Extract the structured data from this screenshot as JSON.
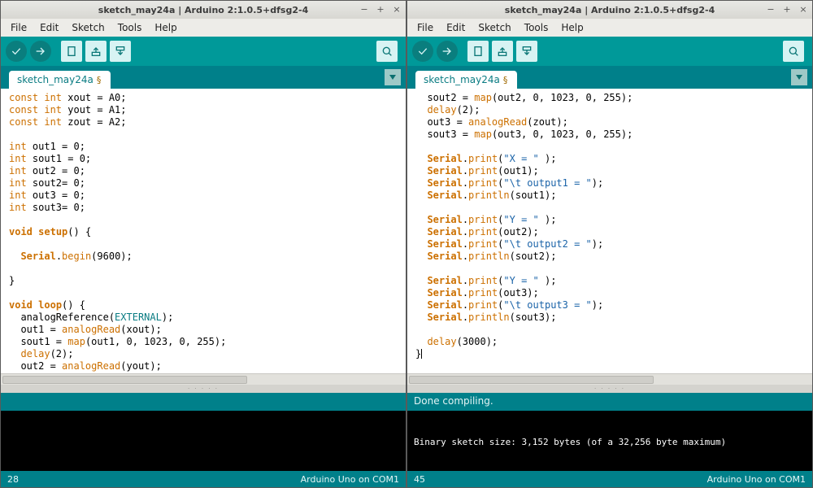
{
  "left": {
    "title": "sketch_may24a | Arduino 2:1.0.5+dfsg2-4",
    "menu": [
      "File",
      "Edit",
      "Sketch",
      "Tools",
      "Help"
    ],
    "tab": "sketch_may24a",
    "dirty_marker": "§",
    "status_teal": "",
    "console": "",
    "line_no": "28",
    "board": "Arduino Uno on COM1",
    "code_tokens": [
      [
        [
          "ty",
          "const int"
        ],
        [
          "",
          " xout = A0;"
        ]
      ],
      [
        [
          "ty",
          "const int"
        ],
        [
          "",
          " yout = A1;"
        ]
      ],
      [
        [
          "ty",
          "const int"
        ],
        [
          "",
          " zout = A2;"
        ]
      ],
      [
        [
          "",
          ""
        ]
      ],
      [
        [
          "ty",
          "int"
        ],
        [
          "",
          " out1 = 0;"
        ]
      ],
      [
        [
          "ty",
          "int"
        ],
        [
          "",
          " sout1 = 0;"
        ]
      ],
      [
        [
          "ty",
          "int"
        ],
        [
          "",
          " out2 = 0;"
        ]
      ],
      [
        [
          "ty",
          "int"
        ],
        [
          "",
          " sout2= 0;"
        ]
      ],
      [
        [
          "ty",
          "int"
        ],
        [
          "",
          " out3 = 0;"
        ]
      ],
      [
        [
          "ty",
          "int"
        ],
        [
          "",
          " sout3= 0;"
        ]
      ],
      [
        [
          "",
          ""
        ]
      ],
      [
        [
          "kw",
          "void"
        ],
        [
          "",
          " "
        ],
        [
          "lib",
          "setup"
        ],
        [
          "",
          "() {"
        ]
      ],
      [
        [
          "",
          ""
        ]
      ],
      [
        [
          "",
          "  "
        ],
        [
          "lib",
          "Serial"
        ],
        [
          "",
          "."
        ],
        [
          "fn",
          "begin"
        ],
        [
          "",
          "(9600);"
        ]
      ],
      [
        [
          "",
          ""
        ]
      ],
      [
        [
          "",
          "}"
        ]
      ],
      [
        [
          "",
          ""
        ]
      ],
      [
        [
          "kw",
          "void"
        ],
        [
          "",
          " "
        ],
        [
          "lib",
          "loop"
        ],
        [
          "",
          "() {"
        ]
      ],
      [
        [
          "",
          "  analogReference("
        ],
        [
          "cnst",
          "EXTERNAL"
        ],
        [
          "",
          ");"
        ]
      ],
      [
        [
          "",
          "  out1 = "
        ],
        [
          "fn",
          "analogRead"
        ],
        [
          "",
          "(xout);"
        ]
      ],
      [
        [
          "",
          "  sout1 = "
        ],
        [
          "fn",
          "map"
        ],
        [
          "",
          "(out1, 0, 1023, 0, 255);"
        ]
      ],
      [
        [
          "",
          "  "
        ],
        [
          "fn",
          "delay"
        ],
        [
          "",
          "(2);"
        ]
      ],
      [
        [
          "",
          "  out2 = "
        ],
        [
          "fn",
          "analogRead"
        ],
        [
          "",
          "(yout);"
        ]
      ]
    ]
  },
  "right": {
    "title": "sketch_may24a | Arduino 2:1.0.5+dfsg2-4",
    "menu": [
      "File",
      "Edit",
      "Sketch",
      "Tools",
      "Help"
    ],
    "tab": "sketch_may24a",
    "dirty_marker": "§",
    "status_teal": "Done compiling.",
    "console": "\n\nBinary sketch size: 3,152 bytes (of a 32,256 byte maximum)",
    "line_no": "45",
    "board": "Arduino Uno on COM1",
    "code_tokens": [
      [
        [
          "",
          "  sout2 = "
        ],
        [
          "fn",
          "map"
        ],
        [
          "",
          "(out2, 0, 1023, 0, 255);"
        ]
      ],
      [
        [
          "",
          "  "
        ],
        [
          "fn",
          "delay"
        ],
        [
          "",
          "(2);"
        ]
      ],
      [
        [
          "",
          "  out3 = "
        ],
        [
          "fn",
          "analogRead"
        ],
        [
          "",
          "(zout);"
        ]
      ],
      [
        [
          "",
          "  sout3 = "
        ],
        [
          "fn",
          "map"
        ],
        [
          "",
          "(out3, 0, 1023, 0, 255);"
        ]
      ],
      [
        [
          "",
          ""
        ]
      ],
      [
        [
          "",
          "  "
        ],
        [
          "lib",
          "Serial"
        ],
        [
          "",
          "."
        ],
        [
          "fn",
          "print"
        ],
        [
          "",
          "("
        ],
        [
          "str",
          "\"X = \""
        ],
        [
          "",
          " );"
        ]
      ],
      [
        [
          "",
          "  "
        ],
        [
          "lib",
          "Serial"
        ],
        [
          "",
          "."
        ],
        [
          "fn",
          "print"
        ],
        [
          "",
          "(out1);"
        ]
      ],
      [
        [
          "",
          "  "
        ],
        [
          "lib",
          "Serial"
        ],
        [
          "",
          "."
        ],
        [
          "fn",
          "print"
        ],
        [
          "",
          "("
        ],
        [
          "str",
          "\"\\t output1 = \""
        ],
        [
          "",
          ");"
        ]
      ],
      [
        [
          "",
          "  "
        ],
        [
          "lib",
          "Serial"
        ],
        [
          "",
          "."
        ],
        [
          "fn",
          "println"
        ],
        [
          "",
          "(sout1);"
        ]
      ],
      [
        [
          "",
          ""
        ]
      ],
      [
        [
          "",
          "  "
        ],
        [
          "lib",
          "Serial"
        ],
        [
          "",
          "."
        ],
        [
          "fn",
          "print"
        ],
        [
          "",
          "("
        ],
        [
          "str",
          "\"Y = \""
        ],
        [
          "",
          " );"
        ]
      ],
      [
        [
          "",
          "  "
        ],
        [
          "lib",
          "Serial"
        ],
        [
          "",
          "."
        ],
        [
          "fn",
          "print"
        ],
        [
          "",
          "(out2);"
        ]
      ],
      [
        [
          "",
          "  "
        ],
        [
          "lib",
          "Serial"
        ],
        [
          "",
          "."
        ],
        [
          "fn",
          "print"
        ],
        [
          "",
          "("
        ],
        [
          "str",
          "\"\\t output2 = \""
        ],
        [
          "",
          ");"
        ]
      ],
      [
        [
          "",
          "  "
        ],
        [
          "lib",
          "Serial"
        ],
        [
          "",
          "."
        ],
        [
          "fn",
          "println"
        ],
        [
          "",
          "(sout2);"
        ]
      ],
      [
        [
          "",
          ""
        ]
      ],
      [
        [
          "",
          "  "
        ],
        [
          "lib",
          "Serial"
        ],
        [
          "",
          "."
        ],
        [
          "fn",
          "print"
        ],
        [
          "",
          "("
        ],
        [
          "str",
          "\"Y = \""
        ],
        [
          "",
          " );"
        ]
      ],
      [
        [
          "",
          "  "
        ],
        [
          "lib",
          "Serial"
        ],
        [
          "",
          "."
        ],
        [
          "fn",
          "print"
        ],
        [
          "",
          "(out3);"
        ]
      ],
      [
        [
          "",
          "  "
        ],
        [
          "lib",
          "Serial"
        ],
        [
          "",
          "."
        ],
        [
          "fn",
          "print"
        ],
        [
          "",
          "("
        ],
        [
          "str",
          "\"\\t output3 = \""
        ],
        [
          "",
          ");"
        ]
      ],
      [
        [
          "",
          "  "
        ],
        [
          "lib",
          "Serial"
        ],
        [
          "",
          "."
        ],
        [
          "fn",
          "println"
        ],
        [
          "",
          "(sout3);"
        ]
      ],
      [
        [
          "",
          ""
        ]
      ],
      [
        [
          "",
          "  "
        ],
        [
          "fn",
          "delay"
        ],
        [
          "",
          "(3000);"
        ]
      ],
      [
        [
          "",
          "}"
        ],
        [
          "caret",
          ""
        ]
      ]
    ]
  },
  "toolbar_icons": [
    "verify",
    "upload",
    "new",
    "open",
    "save",
    "serial-monitor"
  ]
}
